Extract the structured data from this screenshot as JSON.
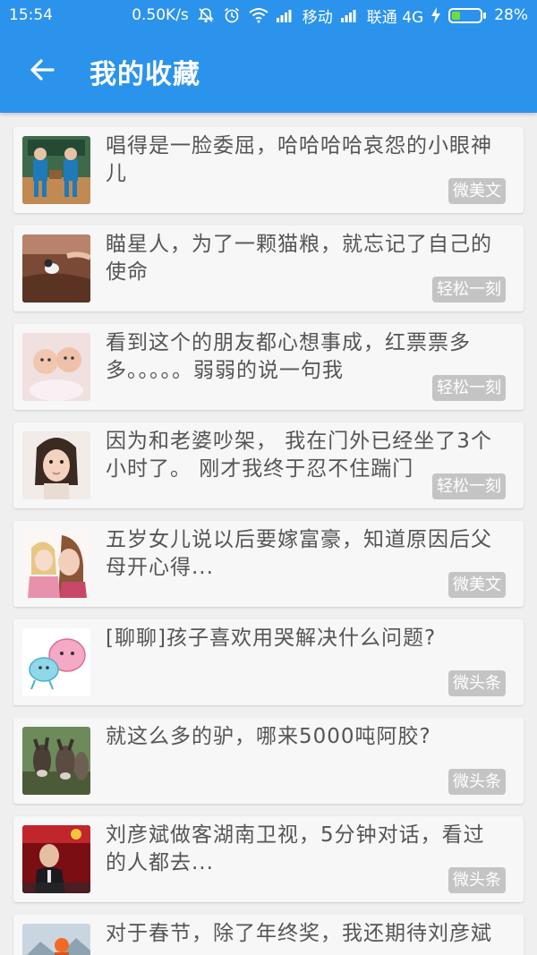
{
  "status_bar": {
    "time": "15:54",
    "net_speed": "0.50K/s",
    "carrier1": "移动",
    "carrier2": "联通 4G",
    "battery": "28%",
    "battery_level": 0.28,
    "battery_color": "#6fdc3a",
    "icons": [
      "mute-icon",
      "alarm-icon",
      "wifi-icon",
      "signal-icon",
      "signal-icon",
      "charging-icon"
    ]
  },
  "app_bar": {
    "title": "我的收藏",
    "back_icon": "arrow-left-icon",
    "color": "#2c93ec"
  },
  "favorites": [
    {
      "title": "唱得是一脸委屈，哈哈哈哈哀怨的小眼神儿",
      "tag": "微美文",
      "thumb": "kids-singing"
    },
    {
      "title": "瞄星人，为了一颗猫粮，就忘记了自己的使命",
      "tag": "轻松一刻",
      "thumb": "cat"
    },
    {
      "title": "看到这个的朋友都心想事成，红票票多多。。。。。弱弱的说一句我",
      "tag": "轻松一刻",
      "thumb": "babies"
    },
    {
      "title": "因为和老婆吵架， 我在门外已经坐了3个小时了。 刚才我终于忍不住踹门",
      "tag": "轻松一刻",
      "thumb": "girl"
    },
    {
      "title": "五岁女儿说以后要嫁富豪，知道原因后父母开心得...",
      "tag": "微美文",
      "thumb": "mother-daughter"
    },
    {
      "title": "[聊聊]孩子喜欢用哭解决什么问题?",
      "tag": "微头条",
      "thumb": "cartoon"
    },
    {
      "title": "就这么多的驴，哪来5000吨阿胶?",
      "tag": "微头条",
      "thumb": "donkeys"
    },
    {
      "title": "刘彦斌做客湖南卫视，5分钟对话，看过的人都去...",
      "tag": "微头条",
      "thumb": "tv-show"
    },
    {
      "title": "对于春节，除了年终奖，我还期待刘彦斌",
      "tag": "",
      "thumb": "winter"
    }
  ]
}
